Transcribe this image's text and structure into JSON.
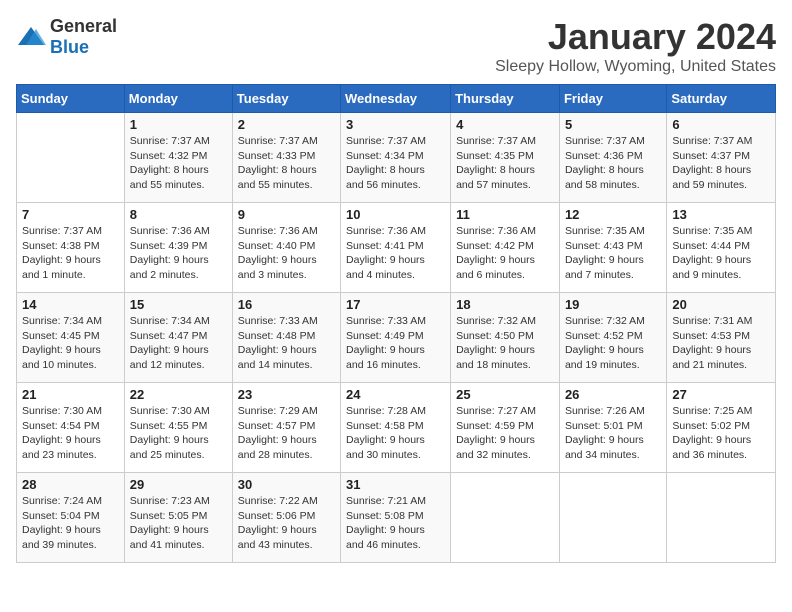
{
  "header": {
    "logo_general": "General",
    "logo_blue": "Blue",
    "month_year": "January 2024",
    "location": "Sleepy Hollow, Wyoming, United States"
  },
  "calendar": {
    "days_of_week": [
      "Sunday",
      "Monday",
      "Tuesday",
      "Wednesday",
      "Thursday",
      "Friday",
      "Saturday"
    ],
    "weeks": [
      [
        {
          "day": "",
          "info": ""
        },
        {
          "day": "1",
          "info": "Sunrise: 7:37 AM\nSunset: 4:32 PM\nDaylight: 8 hours\nand 55 minutes."
        },
        {
          "day": "2",
          "info": "Sunrise: 7:37 AM\nSunset: 4:33 PM\nDaylight: 8 hours\nand 55 minutes."
        },
        {
          "day": "3",
          "info": "Sunrise: 7:37 AM\nSunset: 4:34 PM\nDaylight: 8 hours\nand 56 minutes."
        },
        {
          "day": "4",
          "info": "Sunrise: 7:37 AM\nSunset: 4:35 PM\nDaylight: 8 hours\nand 57 minutes."
        },
        {
          "day": "5",
          "info": "Sunrise: 7:37 AM\nSunset: 4:36 PM\nDaylight: 8 hours\nand 58 minutes."
        },
        {
          "day": "6",
          "info": "Sunrise: 7:37 AM\nSunset: 4:37 PM\nDaylight: 8 hours\nand 59 minutes."
        }
      ],
      [
        {
          "day": "7",
          "info": "Sunrise: 7:37 AM\nSunset: 4:38 PM\nDaylight: 9 hours\nand 1 minute."
        },
        {
          "day": "8",
          "info": "Sunrise: 7:36 AM\nSunset: 4:39 PM\nDaylight: 9 hours\nand 2 minutes."
        },
        {
          "day": "9",
          "info": "Sunrise: 7:36 AM\nSunset: 4:40 PM\nDaylight: 9 hours\nand 3 minutes."
        },
        {
          "day": "10",
          "info": "Sunrise: 7:36 AM\nSunset: 4:41 PM\nDaylight: 9 hours\nand 4 minutes."
        },
        {
          "day": "11",
          "info": "Sunrise: 7:36 AM\nSunset: 4:42 PM\nDaylight: 9 hours\nand 6 minutes."
        },
        {
          "day": "12",
          "info": "Sunrise: 7:35 AM\nSunset: 4:43 PM\nDaylight: 9 hours\nand 7 minutes."
        },
        {
          "day": "13",
          "info": "Sunrise: 7:35 AM\nSunset: 4:44 PM\nDaylight: 9 hours\nand 9 minutes."
        }
      ],
      [
        {
          "day": "14",
          "info": "Sunrise: 7:34 AM\nSunset: 4:45 PM\nDaylight: 9 hours\nand 10 minutes."
        },
        {
          "day": "15",
          "info": "Sunrise: 7:34 AM\nSunset: 4:47 PM\nDaylight: 9 hours\nand 12 minutes."
        },
        {
          "day": "16",
          "info": "Sunrise: 7:33 AM\nSunset: 4:48 PM\nDaylight: 9 hours\nand 14 minutes."
        },
        {
          "day": "17",
          "info": "Sunrise: 7:33 AM\nSunset: 4:49 PM\nDaylight: 9 hours\nand 16 minutes."
        },
        {
          "day": "18",
          "info": "Sunrise: 7:32 AM\nSunset: 4:50 PM\nDaylight: 9 hours\nand 18 minutes."
        },
        {
          "day": "19",
          "info": "Sunrise: 7:32 AM\nSunset: 4:52 PM\nDaylight: 9 hours\nand 19 minutes."
        },
        {
          "day": "20",
          "info": "Sunrise: 7:31 AM\nSunset: 4:53 PM\nDaylight: 9 hours\nand 21 minutes."
        }
      ],
      [
        {
          "day": "21",
          "info": "Sunrise: 7:30 AM\nSunset: 4:54 PM\nDaylight: 9 hours\nand 23 minutes."
        },
        {
          "day": "22",
          "info": "Sunrise: 7:30 AM\nSunset: 4:55 PM\nDaylight: 9 hours\nand 25 minutes."
        },
        {
          "day": "23",
          "info": "Sunrise: 7:29 AM\nSunset: 4:57 PM\nDaylight: 9 hours\nand 28 minutes."
        },
        {
          "day": "24",
          "info": "Sunrise: 7:28 AM\nSunset: 4:58 PM\nDaylight: 9 hours\nand 30 minutes."
        },
        {
          "day": "25",
          "info": "Sunrise: 7:27 AM\nSunset: 4:59 PM\nDaylight: 9 hours\nand 32 minutes."
        },
        {
          "day": "26",
          "info": "Sunrise: 7:26 AM\nSunset: 5:01 PM\nDaylight: 9 hours\nand 34 minutes."
        },
        {
          "day": "27",
          "info": "Sunrise: 7:25 AM\nSunset: 5:02 PM\nDaylight: 9 hours\nand 36 minutes."
        }
      ],
      [
        {
          "day": "28",
          "info": "Sunrise: 7:24 AM\nSunset: 5:04 PM\nDaylight: 9 hours\nand 39 minutes."
        },
        {
          "day": "29",
          "info": "Sunrise: 7:23 AM\nSunset: 5:05 PM\nDaylight: 9 hours\nand 41 minutes."
        },
        {
          "day": "30",
          "info": "Sunrise: 7:22 AM\nSunset: 5:06 PM\nDaylight: 9 hours\nand 43 minutes."
        },
        {
          "day": "31",
          "info": "Sunrise: 7:21 AM\nSunset: 5:08 PM\nDaylight: 9 hours\nand 46 minutes."
        },
        {
          "day": "",
          "info": ""
        },
        {
          "day": "",
          "info": ""
        },
        {
          "day": "",
          "info": ""
        }
      ]
    ]
  }
}
